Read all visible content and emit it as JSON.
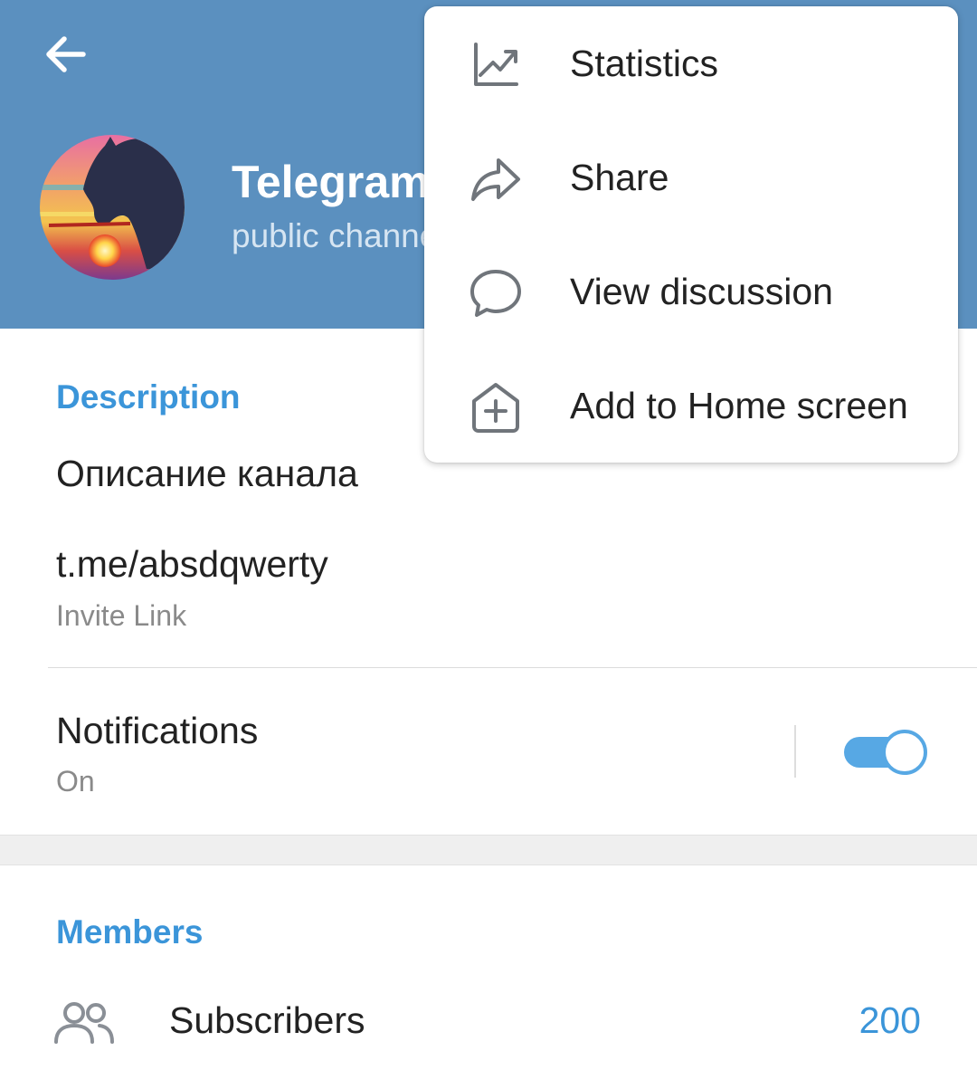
{
  "header": {
    "back_icon": "arrow-left-icon",
    "channel_title": "Telegram",
    "channel_subtitle": "public channel",
    "background_color": "#5b90bf"
  },
  "menu": {
    "items": [
      {
        "label": "Statistics",
        "icon": "chart-line-icon"
      },
      {
        "label": "Share",
        "icon": "share-arrow-icon"
      },
      {
        "label": "View discussion",
        "icon": "speech-bubble-icon"
      },
      {
        "label": "Add to Home screen",
        "icon": "home-add-icon"
      }
    ]
  },
  "info": {
    "description_label": "Description",
    "description_text": "Описание канала",
    "link_text": "t.me/absdqwerty",
    "link_caption": "Invite Link"
  },
  "notifications": {
    "label": "Notifications",
    "status": "On",
    "enabled": true,
    "accent_color": "#57a8e4"
  },
  "members": {
    "section_label": "Members",
    "subscribers_label": "Subscribers",
    "subscribers_count": "200",
    "accent_color": "#3b95d9"
  }
}
